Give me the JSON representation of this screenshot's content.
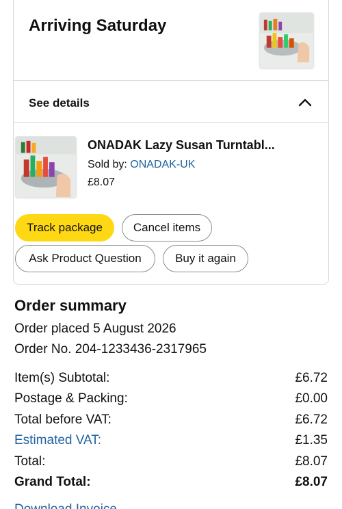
{
  "delivery": {
    "title": "Arriving Saturday"
  },
  "details": {
    "label": "See details"
  },
  "item": {
    "title": "ONADAK Lazy Susan Turntabl...",
    "sold_by_label": "Sold by: ",
    "seller": "ONADAK-UK",
    "price": "£8.07"
  },
  "actions": {
    "track": "Track package",
    "cancel": "Cancel items",
    "ask": "Ask Product Question",
    "buy_again": "Buy it again"
  },
  "summary": {
    "title": "Order summary",
    "placed": "Order placed 5 August 2026",
    "order_no": "Order No. 204-1233436-2317965",
    "rows": [
      {
        "label": "Item(s) Subtotal:",
        "value": "£6.72"
      },
      {
        "label": "Postage & Packing:",
        "value": "£0.00"
      },
      {
        "label": "Total before VAT:",
        "value": "£6.72"
      },
      {
        "label": "Estimated VAT:",
        "value": "£1.35"
      },
      {
        "label": "Total:",
        "value": "£8.07"
      },
      {
        "label": "Grand Total:",
        "value": "£8.07"
      }
    ],
    "invoice_link": "Download Invoice"
  },
  "colors": {
    "primary_button": "#ffd814",
    "link": "#2162a1",
    "border": "#d5d9d9"
  },
  "icons": {
    "collapse": "chevron-up-icon",
    "product_image": "product-thumbnail"
  }
}
